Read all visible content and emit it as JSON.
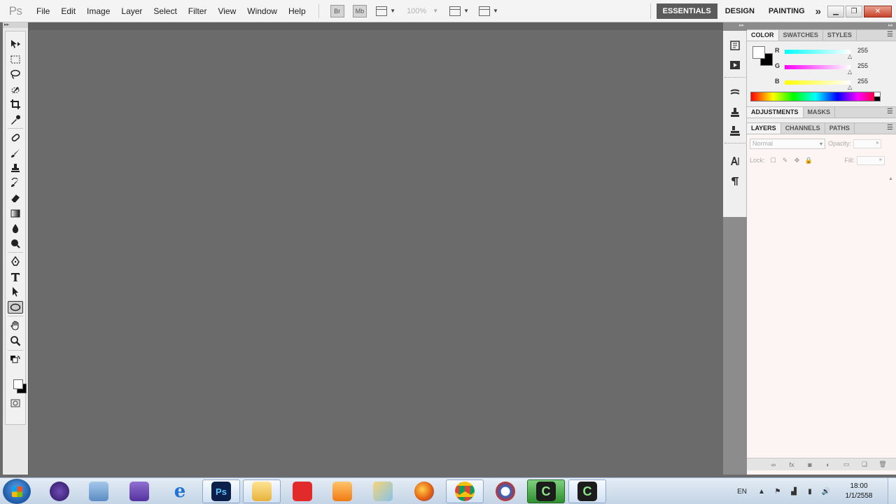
{
  "app": {
    "logo": "Ps",
    "menu": [
      "File",
      "Edit",
      "Image",
      "Layer",
      "Select",
      "Filter",
      "View",
      "Window",
      "Help"
    ],
    "toolbar": {
      "bridge_label": "Br",
      "minibridge_label": "Mb",
      "zoom_level": "100%"
    },
    "workspaces": [
      "ESSENTIALS",
      "DESIGN",
      "PAINTING"
    ],
    "active_workspace": "ESSENTIALS",
    "more_workspaces": "»"
  },
  "tools": [
    "move",
    "rectangular-marquee",
    "lasso",
    "quick-selection",
    "crop",
    "eyedropper",
    "spot-healing",
    "brush",
    "clone-stamp",
    "history-brush",
    "eraser",
    "gradient",
    "blur",
    "dodge",
    "pen",
    "type",
    "path-selection",
    "ellipse",
    "hand",
    "zoom",
    "quick-mask"
  ],
  "selected_tool": "ellipse",
  "colors": {
    "foreground": "#ffffff",
    "background": "#000000",
    "accent": "#5b5b5b",
    "canvas": "#6b6b6b"
  },
  "panels": {
    "color": {
      "tabs": [
        "COLOR",
        "SWATCHES",
        "STYLES"
      ],
      "active_tab": "COLOR",
      "channels": [
        {
          "label": "R",
          "value": "255"
        },
        {
          "label": "G",
          "value": "255"
        },
        {
          "label": "B",
          "value": "255"
        }
      ]
    },
    "adjustments": {
      "tabs": [
        "ADJUSTMENTS",
        "MASKS"
      ],
      "active_tab": "ADJUSTMENTS"
    },
    "layers": {
      "tabs": [
        "LAYERS",
        "CHANNELS",
        "PATHS"
      ],
      "active_tab": "LAYERS",
      "blend_mode": "Normal",
      "opacity_label": "Opacity:",
      "lock_label": "Lock:",
      "fill_label": "Fill:"
    }
  },
  "taskbar": {
    "apps": [
      {
        "name": "eclipse",
        "label": ""
      },
      {
        "name": "calculator",
        "label": ""
      },
      {
        "name": "visual-studio",
        "label": ""
      },
      {
        "name": "internet-explorer",
        "label": "e"
      },
      {
        "name": "photoshop",
        "label": "Ps"
      },
      {
        "name": "file-explorer",
        "label": ""
      },
      {
        "name": "download-manager",
        "label": ""
      },
      {
        "name": "media-player",
        "label": ""
      },
      {
        "name": "paint",
        "label": ""
      },
      {
        "name": "firefox",
        "label": ""
      },
      {
        "name": "chrome",
        "label": ""
      },
      {
        "name": "swish",
        "label": ""
      },
      {
        "name": "camtasia-recorder",
        "label": "C"
      },
      {
        "name": "camtasia-studio",
        "label": "C"
      }
    ],
    "language": "EN",
    "clock_time": "18:00",
    "clock_date": "1/1/2558"
  }
}
